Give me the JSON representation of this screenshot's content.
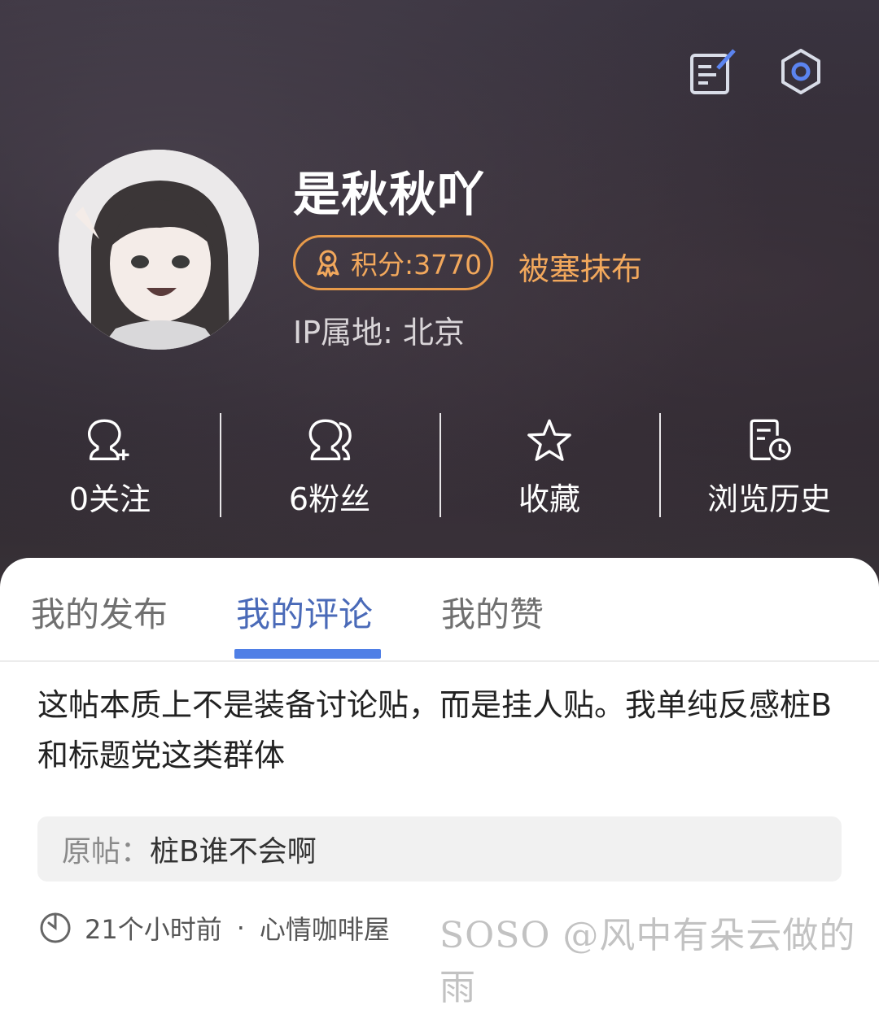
{
  "profile": {
    "username": "是秋秋吖",
    "points_label": "积分:3770",
    "title_badge": "被塞抹布",
    "ip_location": "IP属地: 北京"
  },
  "stats": [
    {
      "icon": "follow-icon",
      "label": "0关注"
    },
    {
      "icon": "fans-icon",
      "label": "6粉丝"
    },
    {
      "icon": "star-icon",
      "label": "收藏"
    },
    {
      "icon": "history-icon",
      "label": "浏览历史"
    }
  ],
  "tabs": [
    {
      "label": "我的发布",
      "active": false
    },
    {
      "label": "我的评论",
      "active": true
    },
    {
      "label": "我的赞",
      "active": false
    }
  ],
  "comment": {
    "text": "这帖本质上不是装备讨论贴，而是挂人贴。我单纯反感桩B和标题党这类群体",
    "quote_prefix": "原帖：",
    "quote_title": "桩B谁不会啊",
    "time": "21个小时前",
    "separator": "·",
    "forum": "心情咖啡屋"
  },
  "watermark": "SOSO @风中有朵云做的雨",
  "colors": {
    "accent_orange": "#e79a4a",
    "tab_active": "#4a6ab8",
    "tab_indicator": "#4f7fe6"
  }
}
